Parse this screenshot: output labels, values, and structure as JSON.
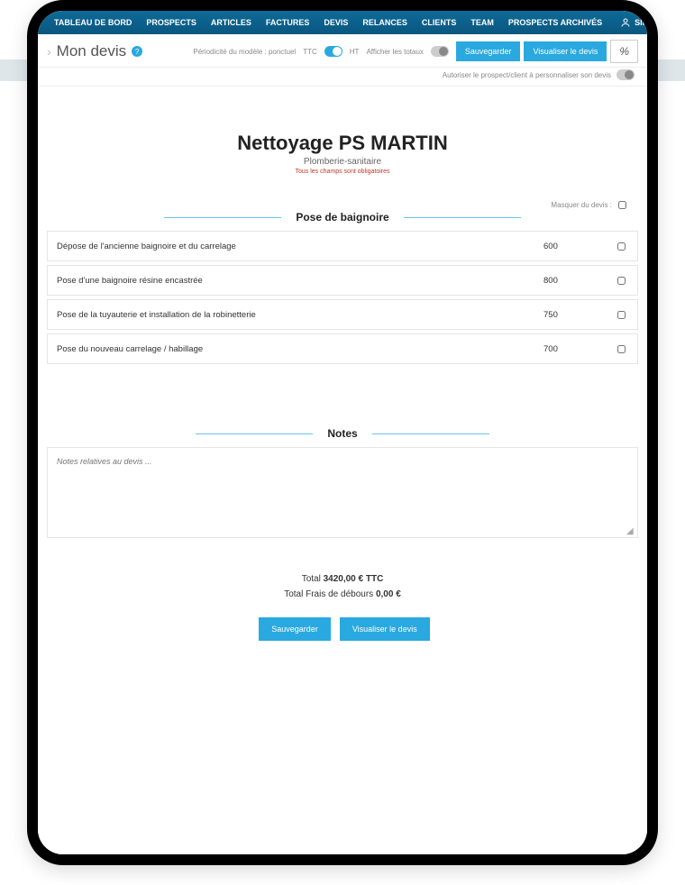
{
  "nav": {
    "items": [
      "TABLEAU DE BORD",
      "PROSPECTS",
      "ARTICLES",
      "FACTURES",
      "DEVIS",
      "RELANCES",
      "CLIENTS",
      "TEAM",
      "PROSPECTS ARCHIVÉS"
    ],
    "user": "SIMON"
  },
  "toolbar": {
    "title": "Mon devis",
    "periodicity": "Périodicité du modèle : ponctuel",
    "ttc": "TTC",
    "ht": "HT",
    "show_totals": "Afficher les totaux",
    "save": "Sauvegarder",
    "view": "Visualiser le devis",
    "percent": "%",
    "allow_client": "Autoriser le prospect/client à personnaliser son devis"
  },
  "header": {
    "title": "Nettoyage PS MARTIN",
    "subtitle": "Plomberie-sanitaire",
    "required": "Tous les champs sont obligatoires"
  },
  "section1": {
    "title": "Pose de baignoire",
    "mask": "Masquer du devis :",
    "items": [
      {
        "desc": "Dépose de l'ancienne baignoire et du carrelage",
        "price": "600"
      },
      {
        "desc": "Pose d'une baignoire résine encastrée",
        "price": "800"
      },
      {
        "desc": "Pose de la tuyauterie et installation de la robinetterie",
        "price": "750"
      },
      {
        "desc": "Pose du nouveau carrelage / habillage",
        "price": "700"
      }
    ]
  },
  "notes": {
    "title": "Notes",
    "placeholder": "Notes relatives au devis ..."
  },
  "totals": {
    "total_label": "Total",
    "total_value": "3420,00 € TTC",
    "fees_label": "Total Frais de débours",
    "fees_value": "0,00 €"
  },
  "footer": {
    "save": "Sauvegarder",
    "view": "Visualiser le devis"
  }
}
